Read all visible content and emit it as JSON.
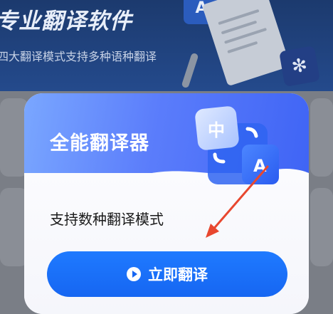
{
  "background": {
    "title": "专业翻译软件",
    "subtitle": "四大翻译模式支持多种语种翻译",
    "tile_a_glyph": "A",
    "tile_x_glyph": "✻"
  },
  "modal": {
    "title": "全能翻译器",
    "description": "支持数种翻译模式",
    "illustration": {
      "tile1_glyph": "中",
      "tile2_glyph": "A"
    },
    "cta": {
      "label": "立即翻译",
      "icon": "play-icon"
    }
  },
  "colors": {
    "header_gradient_start": "#7aa7ff",
    "header_gradient_end": "#3f64f5",
    "cta_blue": "#1666f2",
    "annotation_arrow": "#e8472f"
  }
}
